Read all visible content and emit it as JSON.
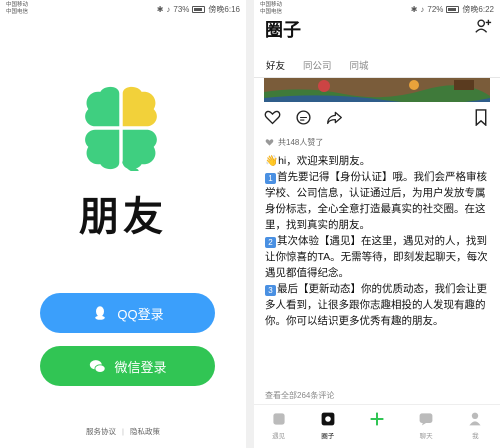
{
  "login_screen": {
    "status": {
      "carrier1": "中国移动",
      "carrier2": "中国电信",
      "battery": "73%",
      "time": "傍晚6:16"
    },
    "brand": "朋友",
    "qq_login": "QQ登录",
    "wechat_login": "微信登录",
    "footer": {
      "service_agreement": "服务协议",
      "privacy_policy": "隐私政策",
      "separator": "|"
    }
  },
  "circle_screen": {
    "status": {
      "carrier1": "中国移动",
      "carrier2": "中国电信",
      "battery": "72%",
      "time": "傍晚6:22"
    },
    "title": "圈子",
    "tabs": [
      "好友",
      "同公司",
      "同城"
    ],
    "likes": "共148人赞了",
    "greeting": "hi，欢迎来到朋友。",
    "paragraphs": [
      {
        "num": "1",
        "text": "首先要记得【身份认证】哦。我们会严格审核学校、公司信息，认证通过后，为用户发放专属身份标志，全心全意打造最真实的社交圈。在这里，找到真实的朋友。"
      },
      {
        "num": "2",
        "text": "其次体验【遇见】在这里，遇见对的人，找到让你惊喜的TA。无需等待，即刻发起聊天，每次遇见都值得纪念。"
      },
      {
        "num": "3",
        "text": "最后【更新动态】你的优质动态，我们会让更多人看到，让很多跟你志趣相投的人发现有趣的你。你可以结识更多优秀有趣的朋友。"
      }
    ],
    "comments": "查看全部264条评论",
    "nav": {
      "meet": "遇见",
      "circle": "圈子",
      "chat": "聊天",
      "me": "我"
    }
  },
  "colors": {
    "qq_blue": "#3b9ffb",
    "wechat_green": "#31c554",
    "clover_green": "#3fcf80",
    "clover_yellow": "#f2d13a",
    "number_badge": "#4a90e2"
  }
}
